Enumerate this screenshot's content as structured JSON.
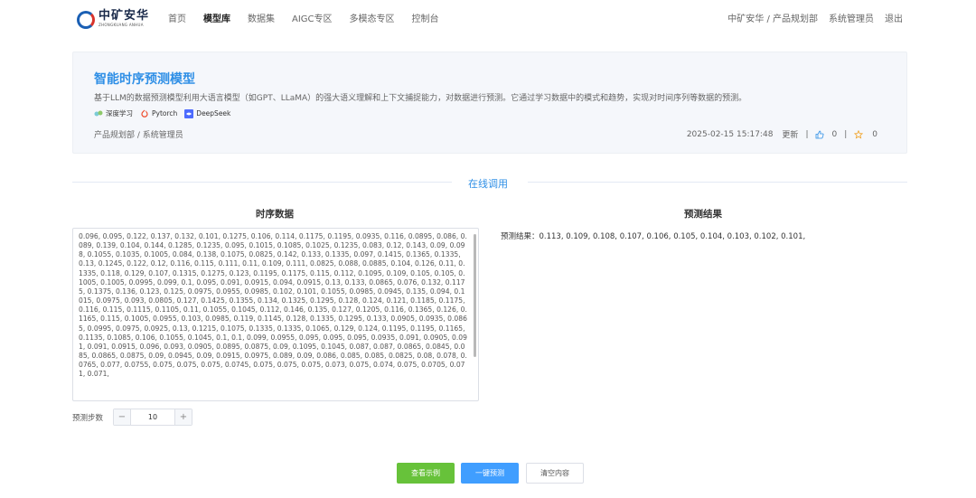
{
  "header": {
    "logo_text": "中矿安华",
    "logo_subtext": "ZHONGKUANG ANHUA",
    "nav": [
      {
        "label": "首页",
        "active": false
      },
      {
        "label": "模型库",
        "active": true
      },
      {
        "label": "数据集",
        "active": false
      },
      {
        "label": "AIGC专区",
        "active": false
      },
      {
        "label": "多模态专区",
        "active": false
      },
      {
        "label": "控制台",
        "active": false
      }
    ],
    "org_path": "中矿安华 / 产品规划部",
    "user": "系统管理员",
    "logout": "退出"
  },
  "model": {
    "title": "智能时序预测模型",
    "description": "基于LLM的数据预测模型利用大语言模型（如GPT、LLaMA）的强大语义理解和上下文捕捉能力，对数据进行预测。它通过学习数据中的模式和趋势，实现对时间序列等数据的预测。",
    "tags": [
      {
        "label": "深度学习",
        "icon": "deep-learning-icon"
      },
      {
        "label": "Pytorch",
        "icon": "pytorch-icon"
      },
      {
        "label": "DeepSeek",
        "icon": "deepseek-icon"
      }
    ],
    "owner": "产品规划部 / 系统管理员",
    "updated_time": "2025-02-15 15:17:48",
    "updated_label": "更新",
    "likes": "0",
    "stars": "0"
  },
  "section_title": "在线调用",
  "input_panel": {
    "title": "时序数据",
    "data_text": "0.096, 0.095, 0.122, 0.137, 0.132, 0.101, 0.1275, 0.106, 0.114, 0.1175, 0.1195, 0.0935, 0.116, 0.0895, 0.086, 0.089, 0.139, 0.104, 0.144, 0.1285, 0.1235, 0.095, 0.1015, 0.1085, 0.1025, 0.1235, 0.083, 0.12, 0.143, 0.09, 0.098, 0.1055, 0.1035, 0.1005, 0.084, 0.138, 0.1075, 0.0825, 0.142, 0.133, 0.1335, 0.097, 0.1415, 0.1365, 0.1335, 0.13, 0.1245, 0.122, 0.12, 0.116, 0.115, 0.111, 0.11, 0.109, 0.111, 0.0825, 0.088, 0.0885, 0.104, 0.126, 0.11, 0.1335, 0.118, 0.129, 0.107, 0.1315, 0.1275, 0.123, 0.1195, 0.1175, 0.115, 0.112, 0.1095, 0.109, 0.105, 0.105, 0.1005, 0.1005, 0.0995, 0.099, 0.1, 0.095, 0.091, 0.0915, 0.094, 0.0915, 0.13, 0.133, 0.0865, 0.076, 0.132, 0.1175, 0.1375, 0.136, 0.123, 0.125, 0.0975, 0.0955, 0.0985, 0.102, 0.101, 0.1055, 0.0985, 0.0945, 0.135, 0.094, 0.1015, 0.0975, 0.093, 0.0805, 0.127, 0.1425, 0.1355, 0.134, 0.1325, 0.1295, 0.128, 0.124, 0.121, 0.1185, 0.1175, 0.116, 0.115, 0.1115, 0.1105, 0.11, 0.1055, 0.1045, 0.112, 0.146, 0.135, 0.127, 0.1205, 0.116, 0.1365, 0.126, 0.1165, 0.115, 0.1005, 0.0955, 0.103, 0.0985, 0.119, 0.1145, 0.128, 0.1335, 0.1295, 0.133, 0.0905, 0.0935, 0.0865, 0.0995, 0.0975, 0.0925, 0.13, 0.1215, 0.1075, 0.1335, 0.1335, 0.1065, 0.129, 0.124, 0.1195, 0.1195, 0.1165, 0.1135, 0.1085, 0.106, 0.1055, 0.1045, 0.1, 0.1, 0.099, 0.0955, 0.095, 0.095, 0.095, 0.0935, 0.091, 0.0905, 0.091, 0.091, 0.0915, 0.096, 0.093, 0.0905, 0.0895, 0.0875, 0.09, 0.1095, 0.1045, 0.087, 0.087, 0.0865, 0.0845, 0.085, 0.0865, 0.0875, 0.09, 0.0945, 0.09, 0.0915, 0.0975, 0.089, 0.09, 0.086, 0.085, 0.085, 0.0825, 0.08, 0.078, 0.0765, 0.077, 0.0755, 0.075, 0.075, 0.075, 0.0745, 0.075, 0.075, 0.075, 0.073, 0.075, 0.074, 0.075, 0.0705, 0.071, 0.071,",
    "steps_label": "预测步数",
    "steps_value": "10"
  },
  "result_panel": {
    "title": "预测结果",
    "result_text": "预测结果：0.113, 0.109, 0.108, 0.107, 0.106, 0.105, 0.104, 0.103, 0.102, 0.101,"
  },
  "actions": {
    "example_label": "查看示例",
    "predict_label": "一键预测",
    "clear_label": "清空内容"
  },
  "colors": {
    "accent": "#2f8fe6",
    "green": "#67c23a",
    "blue": "#409eff"
  }
}
